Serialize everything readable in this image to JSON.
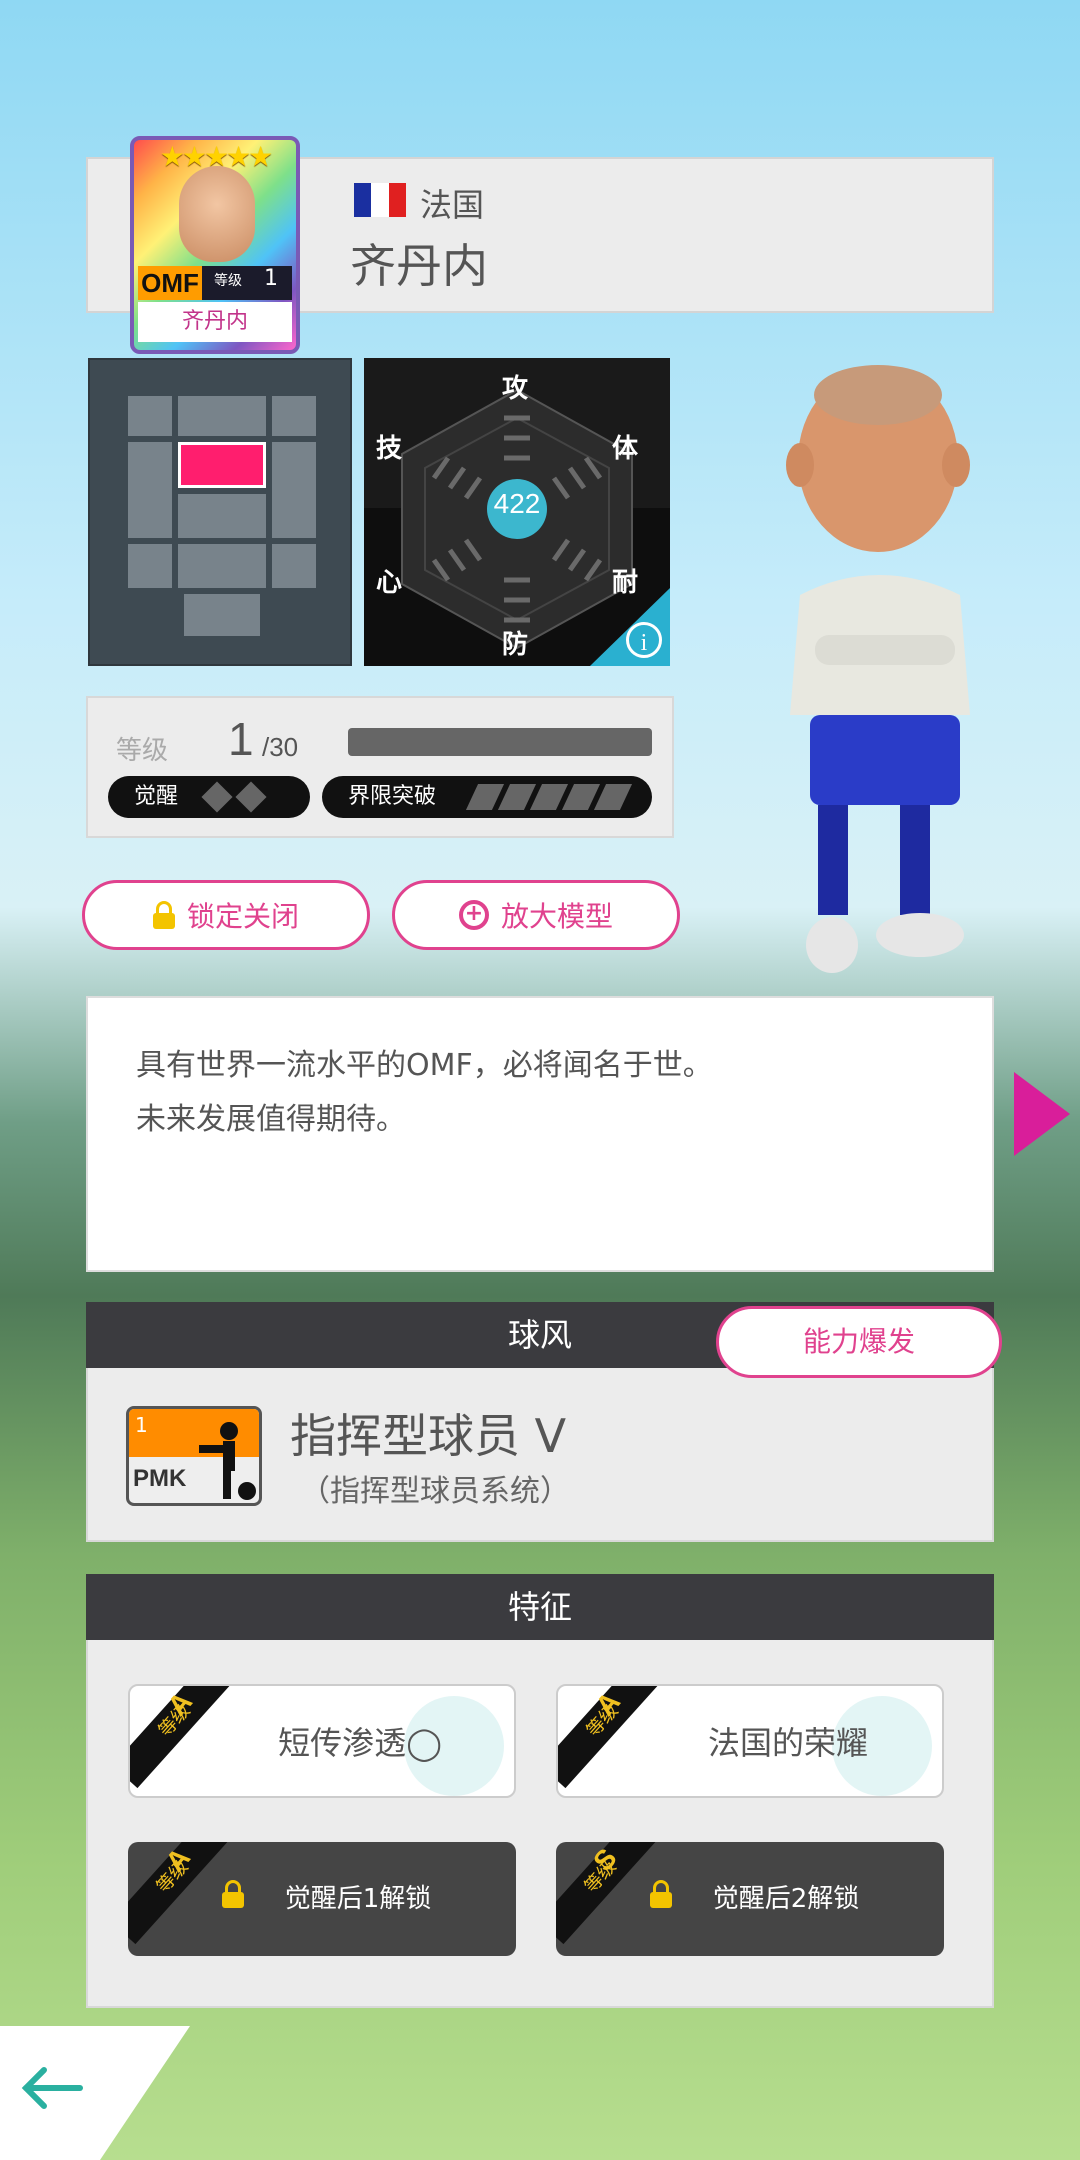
{
  "player": {
    "country": "法国",
    "name": "齐丹内",
    "position": "OMF",
    "level_label": "等级",
    "level": "1",
    "stars": "★★★★★",
    "flag_colors": [
      "#1a2fa0",
      "#ffffff",
      "#e02020"
    ]
  },
  "radar": {
    "labels": {
      "attack": "攻",
      "stamina": "体",
      "endurance": "耐",
      "defense": "防",
      "mind": "心",
      "technique": "技"
    },
    "total": "422"
  },
  "level_box": {
    "label": "等级",
    "current": "1",
    "max": "/30",
    "awaken_label": "觉醒",
    "limit_label": "界限突破"
  },
  "buttons": {
    "lock": "锁定关闭",
    "zoom": "放大模型",
    "burst": "能力爆发"
  },
  "description": {
    "line1": "具有世界一流水平的OMF，必将闻名于世。",
    "line2": "未来发展值得期待。"
  },
  "style": {
    "header": "球风",
    "icon_num": "1",
    "icon_code": "PMK",
    "name": "指挥型球员 V",
    "sub": "（指挥型球员系统）"
  },
  "traits": {
    "header": "特征",
    "items": [
      {
        "grade_label": "等级",
        "grade": "A",
        "text": "短传渗透◯",
        "locked": false
      },
      {
        "grade_label": "等级",
        "grade": "A",
        "text": "法国的荣耀",
        "locked": false
      },
      {
        "grade_label": "等级",
        "grade": "A",
        "text": "觉醒后1解锁",
        "locked": true
      },
      {
        "grade_label": "等级",
        "grade": "S",
        "text": "觉醒后2解锁",
        "locked": true
      }
    ]
  },
  "colors": {
    "accent": "#e0428e",
    "position_highlight": "#ff1e6e",
    "radar_total": "#3ec6e0"
  }
}
